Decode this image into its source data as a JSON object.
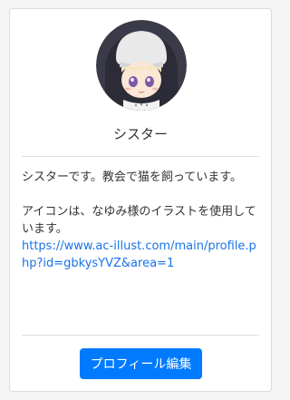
{
  "profile": {
    "name": "シスター",
    "avatar_icon": "nun-character-avatar",
    "bio_line1": "シスターです。教会で猫を飼っています。",
    "bio_line2": "アイコンは、なゆみ様のイラストを使用しています。",
    "link_text": "https://www.ac-illust.com/main/profile.php?id=gbkysYVZ&area=1"
  },
  "actions": {
    "edit_label": "プロフィール編集"
  },
  "colors": {
    "accent": "#007bff",
    "link": "#1a73e8"
  }
}
